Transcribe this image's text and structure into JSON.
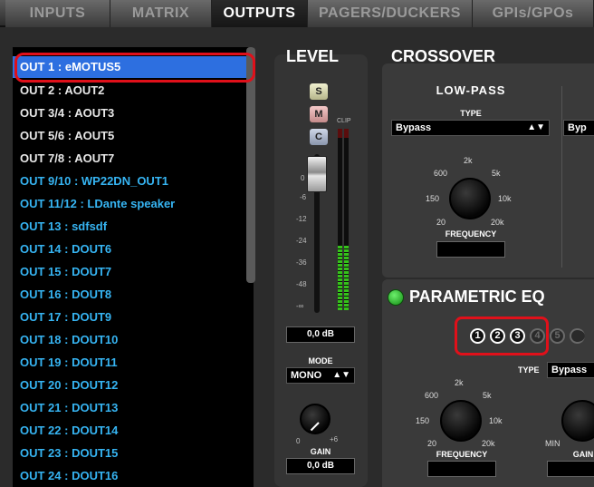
{
  "tabs": [
    {
      "label": "INPUTS",
      "active": false
    },
    {
      "label": "MATRIX",
      "active": false
    },
    {
      "label": "OUTPUTS",
      "active": true
    },
    {
      "label": "PAGERS/DUCKERS",
      "active": false
    },
    {
      "label": "GPIs/GPOs",
      "active": false
    }
  ],
  "outputs": [
    {
      "label": "OUT 1 : eMOTUS5",
      "color": "white",
      "selected": true
    },
    {
      "label": "OUT 2 : AOUT2",
      "color": "white"
    },
    {
      "label": "OUT 3/4 : AOUT3",
      "color": "white"
    },
    {
      "label": "OUT 5/6 : AOUT5",
      "color": "white"
    },
    {
      "label": "OUT 7/8 : AOUT7",
      "color": "white"
    },
    {
      "label": "OUT 9/10 : WP22DN_OUT1",
      "color": "blue"
    },
    {
      "label": "OUT 11/12 : LDante speaker",
      "color": "blue"
    },
    {
      "label": "OUT 13 : sdfsdf",
      "color": "blue"
    },
    {
      "label": "OUT 14 : DOUT6",
      "color": "blue"
    },
    {
      "label": "OUT 15 : DOUT7",
      "color": "blue"
    },
    {
      "label": "OUT 16 : DOUT8",
      "color": "blue"
    },
    {
      "label": "OUT 17 : DOUT9",
      "color": "blue"
    },
    {
      "label": "OUT 18 : DOUT10",
      "color": "blue"
    },
    {
      "label": "OUT 19 : DOUT11",
      "color": "blue"
    },
    {
      "label": "OUT 20 : DOUT12",
      "color": "blue"
    },
    {
      "label": "OUT 21 : DOUT13",
      "color": "blue"
    },
    {
      "label": "OUT 22 : DOUT14",
      "color": "blue"
    },
    {
      "label": "OUT 23 : DOUT15",
      "color": "blue"
    },
    {
      "label": "OUT 24 : DOUT16",
      "color": "blue"
    }
  ],
  "level": {
    "title": "LEVEL",
    "solo": "S",
    "mute": "M",
    "config": "C",
    "clip_label": "CLIP",
    "scale": [
      "0",
      "-6",
      "-12",
      "-24",
      "-36",
      "-48",
      "-∞"
    ],
    "level_readout": "0,0 dB",
    "mode_label": "MODE",
    "mode_value": "MONO",
    "gain_min": "0",
    "gain_max": "+6",
    "gain_label": "GAIN",
    "gain_readout": "0,0 dB"
  },
  "crossover": {
    "title": "CROSSOVER",
    "lowpass_title": "LOW-PASS",
    "type_label": "TYPE",
    "type_value": "Bypass",
    "type_value_right": "Byp",
    "freq_labels": {
      "k2": "2k",
      "f600": "600",
      "k5": "5k",
      "f150": "150",
      "k10": "10k",
      "f20": "20",
      "k20": "20k"
    },
    "frequency_label": "FREQUENCY"
  },
  "peq": {
    "title": "PARAMETRIC EQ",
    "bands": [
      "1",
      "2",
      "3",
      "4",
      "5"
    ],
    "type_label": "TYPE",
    "type_value": "Bypass",
    "freq_labels": {
      "k2": "2k",
      "f600": "600",
      "k5": "5k",
      "f150": "150",
      "k10": "10k",
      "f20": "20",
      "k20": "20k"
    },
    "frequency_label": "FREQUENCY",
    "min_label": "MIN",
    "gain_label": "GAIN"
  },
  "colors": {
    "accent_blue": "#2d6fe0",
    "output_blue": "#36b4f2",
    "highlight_red": "#e0101a",
    "meter_green": "#35c21a",
    "power_green": "#3cd63c"
  }
}
